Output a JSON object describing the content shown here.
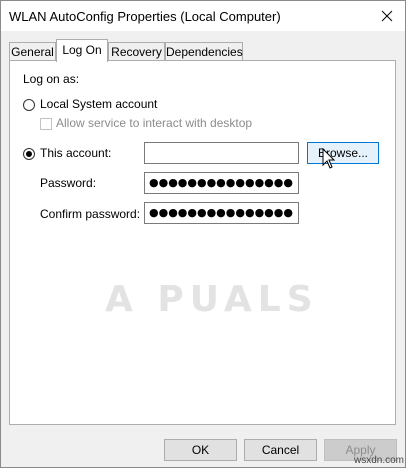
{
  "window": {
    "title": "WLAN AutoConfig Properties (Local Computer)"
  },
  "tabs": [
    {
      "label": "General"
    },
    {
      "label": "Log On"
    },
    {
      "label": "Recovery"
    },
    {
      "label": "Dependencies"
    }
  ],
  "logon": {
    "heading": "Log on as:",
    "local_system_label": "Local System account",
    "allow_interact_label": "Allow service to interact with desktop",
    "this_account_label": "This account:",
    "account_value": "",
    "browse_label": "Browse...",
    "password_label": "Password:",
    "password_value": "●●●●●●●●●●●●●●●",
    "confirm_label": "Confirm password:",
    "confirm_value": "●●●●●●●●●●●●●●●"
  },
  "buttons": {
    "ok": "OK",
    "cancel": "Cancel",
    "apply": "Apply"
  },
  "watermark": "A PUALS",
  "site_credit": "wsxdn.com"
}
